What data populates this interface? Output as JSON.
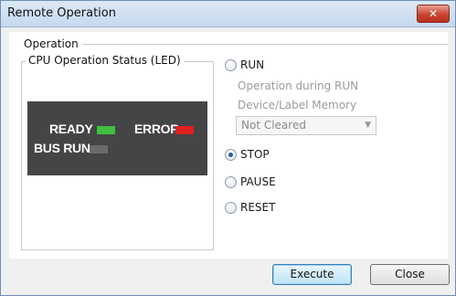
{
  "window": {
    "title": "Remote Operation",
    "close_glyph": "✕"
  },
  "operation_group": {
    "label": "Operation"
  },
  "cpu_status": {
    "label": "CPU Operation Status (LED)",
    "leds": [
      {
        "name": "READY",
        "color": "#3fbf3f"
      },
      {
        "name": "ERROR",
        "color": "#e02020"
      },
      {
        "name": "BUS RUN",
        "color": "#6b6b6b"
      }
    ]
  },
  "options": {
    "run": {
      "label": "RUN",
      "checked": false
    },
    "run_sub": {
      "line1": "Operation during RUN",
      "line2": "Device/Label Memory",
      "combo_value": "Not Cleared"
    },
    "stop": {
      "label": "STOP",
      "checked": true
    },
    "pause": {
      "label": "PAUSE",
      "checked": false
    },
    "reset": {
      "label": "RESET",
      "checked": false
    }
  },
  "buttons": {
    "execute": "Execute",
    "close": "Close"
  },
  "colors": {
    "led_panel": "#444547",
    "accent": "#1f5fa8"
  }
}
